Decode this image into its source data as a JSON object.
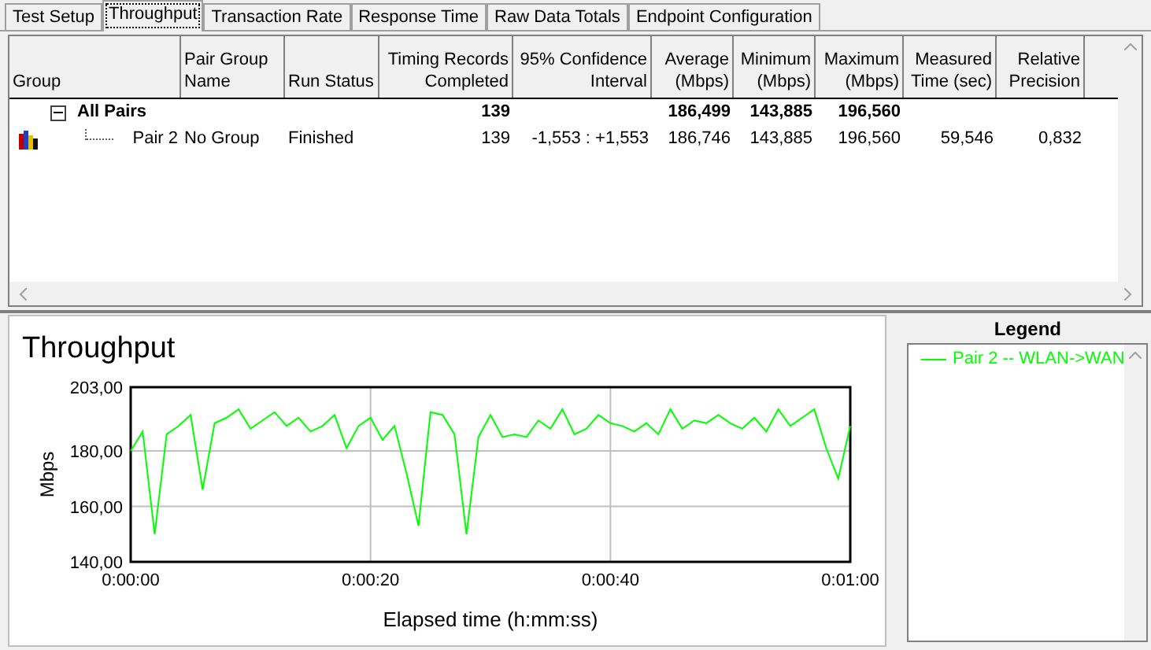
{
  "tabs": [
    {
      "label": "Test Setup",
      "selected": false
    },
    {
      "label": "Throughput",
      "selected": true
    },
    {
      "label": "Transaction Rate",
      "selected": false
    },
    {
      "label": "Response Time",
      "selected": false
    },
    {
      "label": "Raw Data Totals",
      "selected": false
    },
    {
      "label": "Endpoint Configuration",
      "selected": false
    }
  ],
  "table": {
    "columns": [
      {
        "lines": [
          "Group"
        ]
      },
      {
        "lines": [
          "Pair Group",
          "Name"
        ]
      },
      {
        "lines": [
          "Run Status"
        ]
      },
      {
        "lines": [
          "Timing Records",
          "Completed"
        ]
      },
      {
        "lines": [
          "95% Confidence",
          "Interval"
        ]
      },
      {
        "lines": [
          "Average",
          "(Mbps)"
        ]
      },
      {
        "lines": [
          "Minimum",
          "(Mbps)"
        ]
      },
      {
        "lines": [
          "Maximum",
          "(Mbps)"
        ]
      },
      {
        "lines": [
          "Measured",
          "Time (sec)"
        ]
      },
      {
        "lines": [
          "Relative",
          "Precision"
        ]
      }
    ],
    "rows": [
      {
        "kind": "group",
        "expanded": true,
        "cells": [
          "All Pairs",
          "",
          "",
          "139",
          "",
          "186,499",
          "143,885",
          "196,560",
          "",
          ""
        ],
        "children": [
          {
            "kind": "pair",
            "cells": [
              "Pair 2",
              "No Group",
              "Finished",
              "139",
              "-1,553 : +1,553",
              "186,746",
              "143,885",
              "196,560",
              "59,546",
              "0,832"
            ]
          }
        ]
      }
    ]
  },
  "chart": {
    "title": "Throughput",
    "chart_data": {
      "type": "line",
      "grid": true,
      "xlabel": "Elapsed time (h:mm:ss)",
      "ylabel": "Mbps",
      "x": [
        0,
        1,
        2,
        3,
        4,
        5,
        6,
        7,
        8,
        9,
        10,
        11,
        12,
        13,
        14,
        15,
        16,
        17,
        18,
        19,
        20,
        21,
        22,
        23,
        24,
        25,
        26,
        27,
        28,
        29,
        30,
        31,
        32,
        33,
        34,
        35,
        36,
        37,
        38,
        39,
        40,
        41,
        42,
        43,
        44,
        45,
        46,
        47,
        48,
        49,
        50,
        51,
        52,
        53,
        54,
        55,
        56,
        57,
        58,
        59,
        60
      ],
      "series": [
        {
          "name": "Pair 2 -- WLAN->WAN",
          "color": "#00ff00",
          "values": [
            180,
            187,
            150,
            186,
            189,
            193,
            166,
            190,
            192,
            195,
            188,
            191,
            194,
            189,
            192,
            187,
            189,
            193,
            181,
            189,
            192,
            184,
            189,
            172,
            153,
            194,
            193,
            186,
            150,
            185,
            193,
            185,
            186,
            185,
            191,
            188,
            195,
            186,
            188,
            193,
            190,
            189,
            187,
            190,
            186,
            195,
            188,
            191,
            190,
            193,
            190,
            188,
            192,
            187,
            195,
            189,
            192,
            195,
            181,
            170,
            189
          ]
        }
      ],
      "xlim": [
        0,
        60
      ],
      "ylim": [
        140,
        203
      ],
      "xticks": [
        {
          "value": 0,
          "label": "0:00:00"
        },
        {
          "value": 20,
          "label": "0:00:20"
        },
        {
          "value": 40,
          "label": "0:00:40"
        },
        {
          "value": 60,
          "label": "0:01:00"
        }
      ],
      "yticks": [
        {
          "value": 140,
          "label": "140,00"
        },
        {
          "value": 160,
          "label": "160,00"
        },
        {
          "value": 180,
          "label": "180,00"
        },
        {
          "value": 203,
          "label": "203,00"
        }
      ]
    }
  },
  "legend": {
    "title": "Legend"
  }
}
